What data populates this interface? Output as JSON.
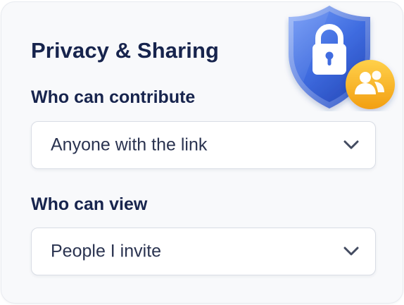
{
  "panel": {
    "title": "Privacy & Sharing"
  },
  "contribute": {
    "label": "Who can contribute",
    "selected_value": "Anyone with the link"
  },
  "view": {
    "label": "Who can view",
    "selected_value": "People I invite"
  },
  "icons": {
    "dropdown": "chevron-down-icon",
    "shield": "shield-lock-icon",
    "group": "users-icon"
  },
  "colors": {
    "heading": "#17244d",
    "shield_blue": "#3f6ce0",
    "badge_orange": "#f6b21f"
  }
}
